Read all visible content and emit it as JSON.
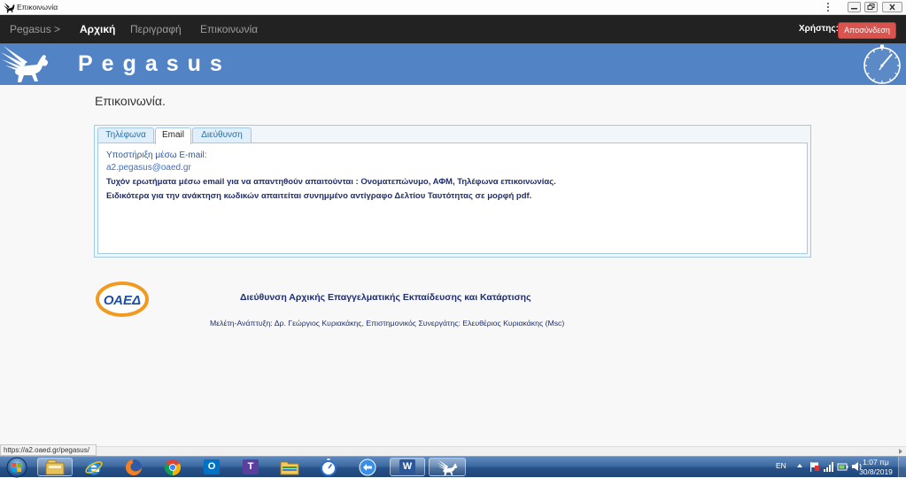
{
  "window": {
    "title": "Επικοινωνία",
    "icon": "pegasus-favicon-icon",
    "controls": [
      "more-options-icon",
      "minimize-icon",
      "restore-icon",
      "close-icon"
    ]
  },
  "navbar": {
    "brand": "Pegasus >",
    "items": [
      {
        "label": "Αρχική",
        "active": true
      },
      {
        "label": "Περιγραφή",
        "active": false
      },
      {
        "label": "Επικοινωνία",
        "active": false
      }
    ],
    "user_label": "Χρήστης:",
    "logout_label": "Αποσύνδεση"
  },
  "banner": {
    "title": "Pegasus",
    "logo_icon": "pegasus-logo-icon",
    "clock_icon": "clock-icon"
  },
  "page": {
    "heading": "Επικοινωνία."
  },
  "tabs": {
    "items": [
      {
        "label": "Τηλέφωνα",
        "active": false
      },
      {
        "label": "Email",
        "active": true
      },
      {
        "label": "Διεύθυνση",
        "active": false
      }
    ],
    "email_panel": {
      "support_label": "Υποστήριξη μέσω E-mail:",
      "email": "a2.pegasus@oaed.gr",
      "note_requirements": "Τυχόν ερωτήματα μέσω email για να απαντηθούν απαιτούνται : Ονοματεπώνυμο, ΑΦΜ, Τηλέφωνα επικοινωνίας.",
      "note_password": "Ειδικότερα για την ανάκτηση κωδικών απαιτείται συνημμένο αντίγραφο Δελτίου Ταυτότητας σε μορφή pdf."
    }
  },
  "footer": {
    "logo_text": "ΟΑΕΔ",
    "organization": "Διεύθυνση Αρχικής Επαγγελματικής Εκπαίδευσης και Κατάρτισης",
    "credits": "Μελέτη-Ανάπτυξη: Δρ. Γεώργιος Κυριακάκης, Επιστημονικός Συνεργάτης: Ελευθέριος Κυριακάκης (Msc)"
  },
  "status_bar": {
    "url": "https://a2.oaed.gr/pegasus/"
  },
  "taskbar": {
    "start_icon": "windows-start-icon",
    "apps": [
      {
        "icon": "libraries-icon",
        "active": true
      },
      {
        "icon": "internet-explorer-icon",
        "active": false
      },
      {
        "icon": "firefox-icon",
        "active": false
      },
      {
        "icon": "chrome-icon",
        "active": false
      },
      {
        "icon": "outlook-icon",
        "glyph": "O",
        "active": false
      },
      {
        "icon": "t-app-icon",
        "glyph": "T",
        "active": false
      },
      {
        "icon": "folder-icon",
        "active": false
      },
      {
        "icon": "stopwatch-icon",
        "active": false
      },
      {
        "icon": "network-app-icon",
        "active": false
      },
      {
        "icon": "word-icon",
        "glyph": "W",
        "active": true
      },
      {
        "icon": "pegasus-app-icon",
        "active": true
      }
    ],
    "language": "EN",
    "tray_icons": [
      "show-hidden-icons-icon",
      "action-center-flag-icon",
      "network-icon",
      "power-icon",
      "volume-icon"
    ],
    "time": "1:07 πμ",
    "date": "30/8/2019"
  },
  "colors": {
    "navbar_bg": "#222222",
    "banner_bg": "#5283c4",
    "logout_bg": "#d9534f",
    "tab_border": "#a6c9e2",
    "panel_text": "#1f2f6f",
    "link_text": "#3f6fbf",
    "logo_orange": "#f29a1f",
    "logo_blue": "#1f4fa0"
  }
}
